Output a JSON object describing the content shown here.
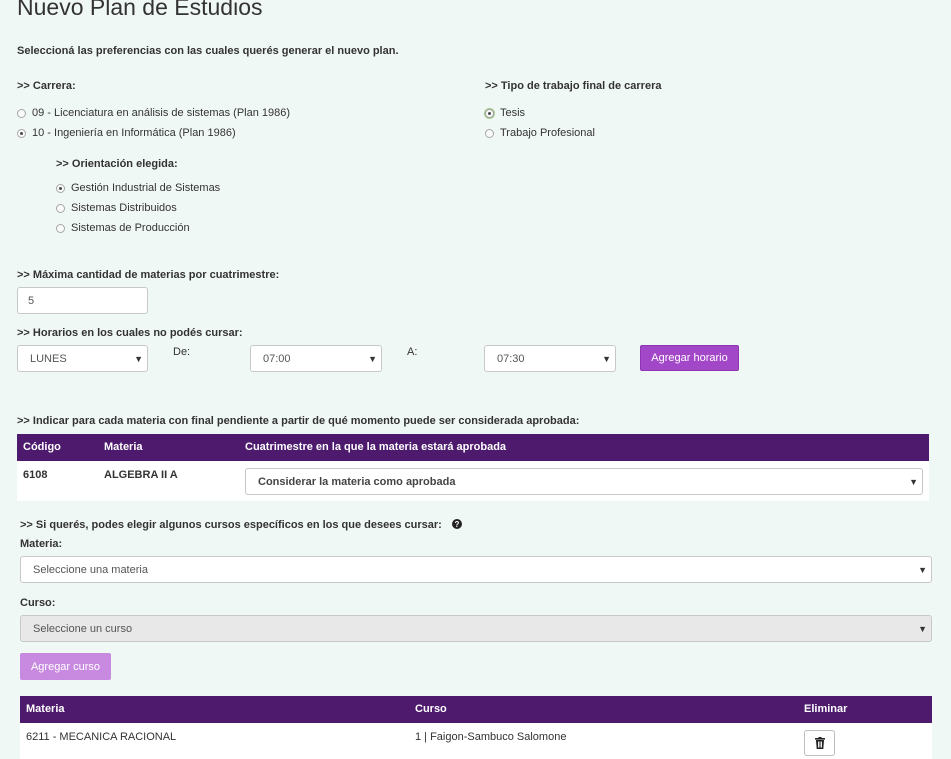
{
  "page": {
    "title": "Nuevo Plan de Estudios",
    "intro": "Seleccioná las preferencias con las cuales querés generar el nuevo plan."
  },
  "carrera": {
    "label": ">> Carrera:",
    "options": [
      {
        "label": "09 - Licenciatura en análisis de sistemas (Plan 1986)",
        "selected": false
      },
      {
        "label": "10 - Ingeniería en Informática (Plan 1986)",
        "selected": true
      }
    ]
  },
  "tipo_trabajo": {
    "label": ">> Tipo de trabajo final de carrera",
    "options": [
      {
        "label": "Tesis",
        "selected": true
      },
      {
        "label": "Trabajo Profesional",
        "selected": false
      }
    ]
  },
  "orientacion": {
    "label": ">> Orientación elegida:",
    "options": [
      {
        "label": "Gestión Industrial de Sistemas",
        "selected": true
      },
      {
        "label": "Sistemas Distribuidos",
        "selected": false
      },
      {
        "label": "Sistemas de Producción",
        "selected": false
      }
    ]
  },
  "max_materias": {
    "label": ">> Máxima cantidad de materias por cuatrimestre:",
    "value": "5"
  },
  "horarios": {
    "label": ">> Horarios en los cuales no podés cursar:",
    "day": "LUNES",
    "de_label": "De:",
    "from": "07:00",
    "a_label": "A:",
    "to": "07:30",
    "add_button": "Agregar horario"
  },
  "finales": {
    "label": ">> Indicar para cada materia con final pendiente a partir de qué momento puede ser considerada aprobada:",
    "headers": [
      "Código",
      "Materia",
      "Cuatrimestre en la que la materia estará aprobada"
    ],
    "rows": [
      {
        "codigo": "6108",
        "materia": "ALGEBRA II A",
        "cuatrimestre": "Considerar la materia como aprobada"
      }
    ]
  },
  "cursos": {
    "label": ">> Si querés, podes elegir algunos cursos específicos en los que desees cursar:",
    "materia_label": "Materia:",
    "materia_placeholder": "Seleccione una materia",
    "curso_label": "Curso:",
    "curso_placeholder": "Seleccione un curso",
    "add_button": "Agregar curso",
    "headers": [
      "Materia",
      "Curso",
      "Eliminar"
    ],
    "rows": [
      {
        "materia": "6211 - MECANICA RACIONAL",
        "curso": "1 | Faigon-Sambuco Salomone"
      }
    ]
  },
  "colors": {
    "accent": "#a347c9",
    "table_header": "#4d1a6e",
    "background": "#f0f8f6"
  },
  "icons": {
    "help": "question-circle-icon",
    "delete": "trash-icon",
    "caret": "caret-down-icon"
  }
}
